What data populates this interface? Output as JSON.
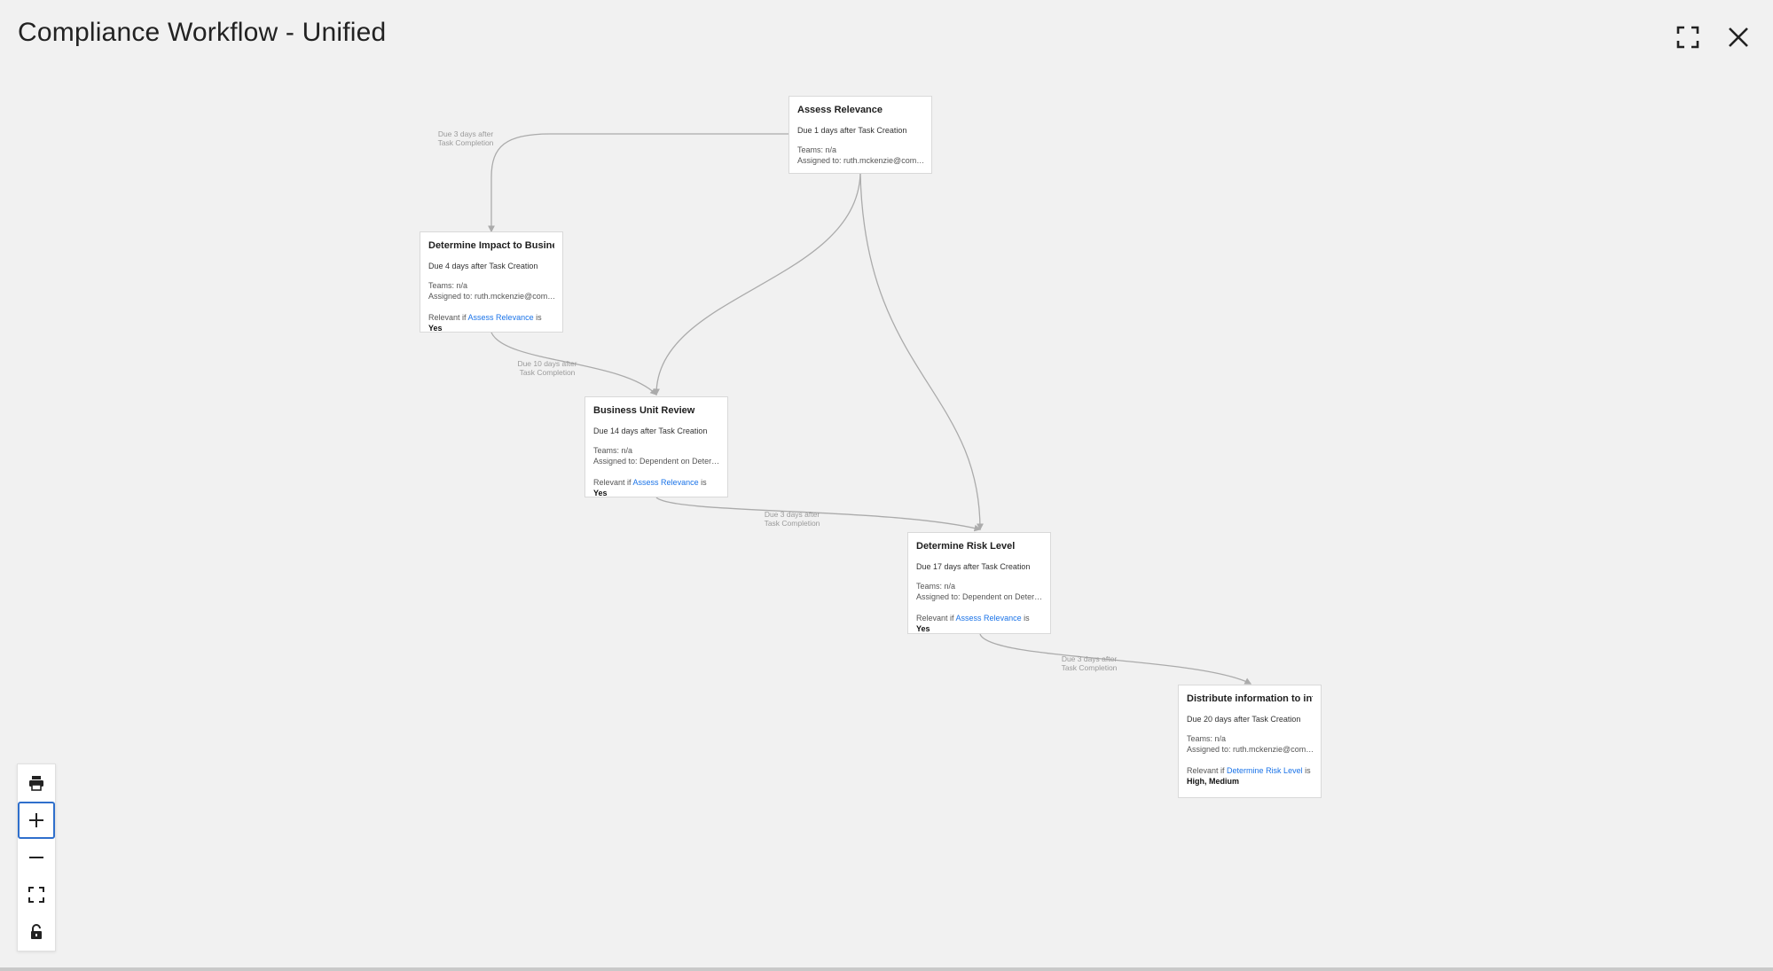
{
  "header": {
    "title": "Compliance Workflow - Unified",
    "fullscreen_icon": "fullscreen-icon",
    "close_icon": "close-icon"
  },
  "colors": {
    "background": "#f1f1f1",
    "link": "#1a73e8",
    "edge": "#ababab",
    "active_border": "#2f6fcc"
  },
  "nodes": [
    {
      "id": "assess-relevance",
      "title": "Assess Relevance",
      "due": "Due 1 days after Task Creation",
      "teams": "Teams: n/a",
      "assigned": "Assigned to: ruth.mckenzie@com…"
    },
    {
      "id": "determine-impact",
      "title": "Determine Impact to Busine…",
      "due": "Due 4 days after Task Creation",
      "teams": "Teams: n/a",
      "assigned": "Assigned to: ruth.mckenzie@com…",
      "relevant_prefix": "Relevant if",
      "relevant_link": "Assess Relevance",
      "relevant_is": "is",
      "relevant_value": "Yes"
    },
    {
      "id": "business-unit-review",
      "title": "Business Unit Review",
      "due": "Due 14 days after Task Creation",
      "teams": "Teams: n/a",
      "assigned": "Assigned to: Dependent on Deter…",
      "relevant_prefix": "Relevant if",
      "relevant_link": "Assess Relevance",
      "relevant_is": "is",
      "relevant_value": "Yes"
    },
    {
      "id": "determine-risk-level",
      "title": "Determine Risk Level",
      "due": "Due 17 days after Task Creation",
      "teams": "Teams: n/a",
      "assigned": "Assigned to: Dependent on Deter…",
      "relevant_prefix": "Relevant if",
      "relevant_link": "Assess Relevance",
      "relevant_is": "is",
      "relevant_value": "Yes"
    },
    {
      "id": "distribute-information",
      "title": "Distribute information to int…",
      "due": "Due 20 days after Task Creation",
      "teams": "Teams: n/a",
      "assigned": "Assigned to: ruth.mckenzie@com…",
      "relevant_prefix": "Relevant if",
      "relevant_link": "Determine Risk Level",
      "relevant_is": "is",
      "relevant_value": "High, Medium"
    }
  ],
  "edge_labels": [
    {
      "line1": "Due 3 days after",
      "line2": "Task Completion"
    },
    {
      "line1": "Due 10 days after",
      "line2": "Task Completion"
    },
    {
      "line1": "Due 3 days after",
      "line2": "Task Completion"
    },
    {
      "line1": "Due 3 days after",
      "line2": "Task Completion"
    }
  ],
  "toolbar": [
    {
      "name": "print-button",
      "icon": "print-icon"
    },
    {
      "name": "zoom-in-button",
      "icon": "plus-icon",
      "active": true
    },
    {
      "name": "zoom-out-button",
      "icon": "minus-icon"
    },
    {
      "name": "fit-to-screen-button",
      "icon": "fit-screen-icon"
    },
    {
      "name": "lock-button",
      "icon": "unlock-icon"
    }
  ]
}
